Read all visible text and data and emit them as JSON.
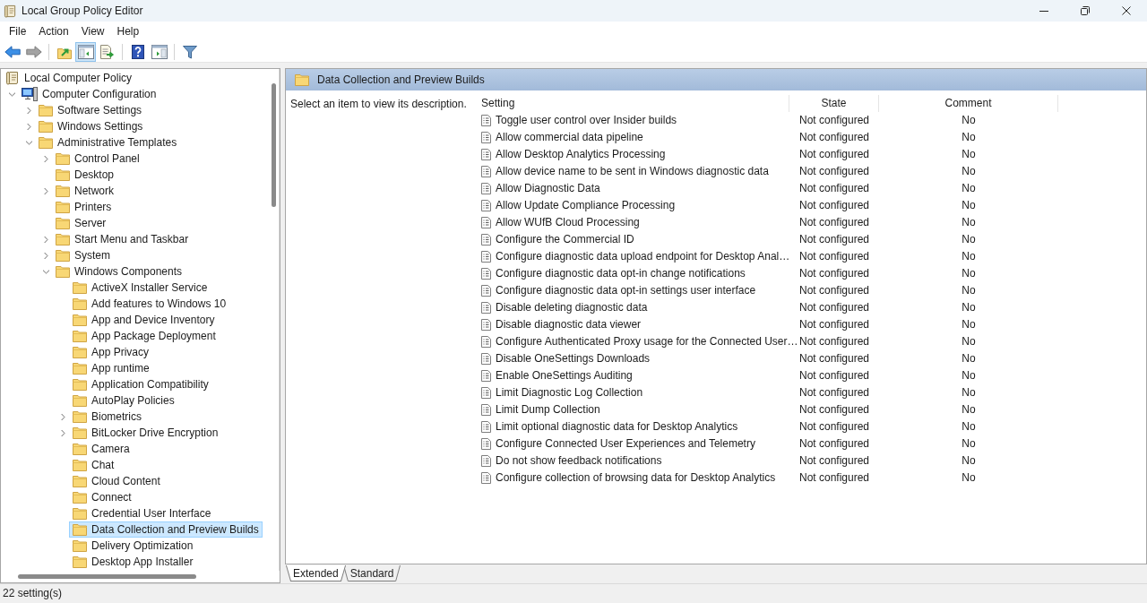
{
  "window": {
    "title": "Local Group Policy Editor"
  },
  "menu": [
    "File",
    "Action",
    "View",
    "Help"
  ],
  "toolbar": [
    {
      "kind": "back",
      "disabled": false,
      "pressed": false
    },
    {
      "kind": "forward",
      "disabled": true,
      "pressed": false
    },
    {
      "kind": "separator"
    },
    {
      "kind": "up",
      "disabled": false,
      "pressed": false
    },
    {
      "kind": "tree",
      "disabled": false,
      "pressed": true
    },
    {
      "kind": "export",
      "disabled": false,
      "pressed": false
    },
    {
      "kind": "separator"
    },
    {
      "kind": "help",
      "disabled": false,
      "pressed": false
    },
    {
      "kind": "pane",
      "disabled": false,
      "pressed": false
    },
    {
      "kind": "separator"
    },
    {
      "kind": "filter",
      "disabled": false,
      "pressed": false
    }
  ],
  "tree": {
    "items": [
      {
        "label": "Local Computer Policy",
        "kind": "policy",
        "selected": false,
        "children": [
          {
            "label": "Computer Configuration",
            "kind": "computer",
            "expanded": true,
            "selected": false,
            "children": [
              {
                "label": "Software Settings",
                "kind": "folder",
                "expanded": false,
                "selected": false
              },
              {
                "label": "Windows Settings",
                "kind": "folder",
                "expanded": false,
                "selected": false
              },
              {
                "label": "Administrative Templates",
                "kind": "folder",
                "expanded": true,
                "selected": false,
                "children": [
                  {
                    "label": "Control Panel",
                    "kind": "folder",
                    "expanded": false,
                    "selected": false
                  },
                  {
                    "label": "Desktop",
                    "kind": "folder",
                    "selected": false
                  },
                  {
                    "label": "Network",
                    "kind": "folder",
                    "expanded": false,
                    "selected": false
                  },
                  {
                    "label": "Printers",
                    "kind": "folder",
                    "selected": false
                  },
                  {
                    "label": "Server",
                    "kind": "folder",
                    "selected": false
                  },
                  {
                    "label": "Start Menu and Taskbar",
                    "kind": "folder",
                    "expanded": false,
                    "selected": false
                  },
                  {
                    "label": "System",
                    "kind": "folder",
                    "expanded": false,
                    "selected": false
                  },
                  {
                    "label": "Windows Components",
                    "kind": "folder",
                    "expanded": true,
                    "selected": false,
                    "children": [
                      {
                        "label": "ActiveX Installer Service",
                        "kind": "folder",
                        "selected": false
                      },
                      {
                        "label": "Add features to Windows 10",
                        "kind": "folder",
                        "selected": false
                      },
                      {
                        "label": "App and Device Inventory",
                        "kind": "folder",
                        "selected": false
                      },
                      {
                        "label": "App Package Deployment",
                        "kind": "folder",
                        "selected": false
                      },
                      {
                        "label": "App Privacy",
                        "kind": "folder",
                        "selected": false
                      },
                      {
                        "label": "App runtime",
                        "kind": "folder",
                        "selected": false
                      },
                      {
                        "label": "Application Compatibility",
                        "kind": "folder",
                        "selected": false
                      },
                      {
                        "label": "AutoPlay Policies",
                        "kind": "folder",
                        "selected": false
                      },
                      {
                        "label": "Biometrics",
                        "kind": "folder",
                        "expanded": false,
                        "selected": false
                      },
                      {
                        "label": "BitLocker Drive Encryption",
                        "kind": "folder",
                        "expanded": false,
                        "selected": false
                      },
                      {
                        "label": "Camera",
                        "kind": "folder",
                        "selected": false
                      },
                      {
                        "label": "Chat",
                        "kind": "folder",
                        "selected": false
                      },
                      {
                        "label": "Cloud Content",
                        "kind": "folder",
                        "selected": false
                      },
                      {
                        "label": "Connect",
                        "kind": "folder",
                        "selected": false
                      },
                      {
                        "label": "Credential User Interface",
                        "kind": "folder",
                        "selected": false
                      },
                      {
                        "label": "Data Collection and Preview Builds",
                        "kind": "folder",
                        "selected": true
                      },
                      {
                        "label": "Delivery Optimization",
                        "kind": "folder",
                        "selected": false
                      },
                      {
                        "label": "Desktop App Installer",
                        "kind": "folder",
                        "selected": false
                      }
                    ]
                  }
                ]
              }
            ]
          }
        ]
      }
    ]
  },
  "details": {
    "title": "Data Collection and Preview Builds",
    "description": "Select an item to view its description.",
    "columns": [
      "Setting",
      "State",
      "Comment"
    ],
    "rows": [
      {
        "setting": "Toggle user control over Insider builds",
        "state": "Not configured",
        "comment": "No"
      },
      {
        "setting": "Allow commercial data pipeline",
        "state": "Not configured",
        "comment": "No"
      },
      {
        "setting": "Allow Desktop Analytics Processing",
        "state": "Not configured",
        "comment": "No"
      },
      {
        "setting": "Allow device name to be sent in Windows diagnostic data",
        "state": "Not configured",
        "comment": "No"
      },
      {
        "setting": "Allow Diagnostic Data",
        "state": "Not configured",
        "comment": "No"
      },
      {
        "setting": "Allow Update Compliance Processing",
        "state": "Not configured",
        "comment": "No"
      },
      {
        "setting": "Allow WUfB Cloud Processing",
        "state": "Not configured",
        "comment": "No"
      },
      {
        "setting": "Configure the Commercial ID",
        "state": "Not configured",
        "comment": "No"
      },
      {
        "setting": "Configure diagnostic data upload endpoint for Desktop Anal…",
        "state": "Not configured",
        "comment": "No"
      },
      {
        "setting": "Configure diagnostic data opt-in change notifications",
        "state": "Not configured",
        "comment": "No"
      },
      {
        "setting": "Configure diagnostic data opt-in settings user interface",
        "state": "Not configured",
        "comment": "No"
      },
      {
        "setting": "Disable deleting diagnostic data",
        "state": "Not configured",
        "comment": "No"
      },
      {
        "setting": "Disable diagnostic data viewer",
        "state": "Not configured",
        "comment": "No"
      },
      {
        "setting": "Configure Authenticated Proxy usage for the Connected User…",
        "state": "Not configured",
        "comment": "No"
      },
      {
        "setting": "Disable OneSettings Downloads",
        "state": "Not configured",
        "comment": "No"
      },
      {
        "setting": "Enable OneSettings Auditing",
        "state": "Not configured",
        "comment": "No"
      },
      {
        "setting": "Limit Diagnostic Log Collection",
        "state": "Not configured",
        "comment": "No"
      },
      {
        "setting": "Limit Dump Collection",
        "state": "Not configured",
        "comment": "No"
      },
      {
        "setting": "Limit optional diagnostic data for Desktop Analytics",
        "state": "Not configured",
        "comment": "No"
      },
      {
        "setting": "Configure Connected User Experiences and Telemetry",
        "state": "Not configured",
        "comment": "No"
      },
      {
        "setting": "Do not show feedback notifications",
        "state": "Not configured",
        "comment": "No"
      },
      {
        "setting": "Configure collection of browsing data for Desktop Analytics",
        "state": "Not configured",
        "comment": "No"
      }
    ]
  },
  "view_tabs": [
    {
      "label": "Extended",
      "selected": true
    },
    {
      "label": "Standard",
      "selected": false
    }
  ],
  "status_bar": {
    "text": "22 setting(s)"
  }
}
